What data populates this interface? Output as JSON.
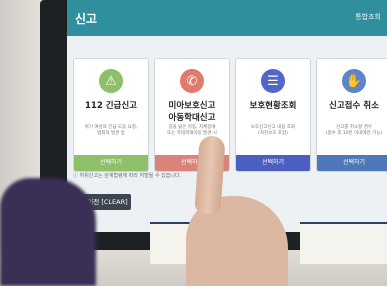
{
  "screen": {
    "title": "신고",
    "top_right": "통합조회",
    "cards": [
      {
        "title1": "112 긴급신고",
        "title2": "",
        "desc": "위기 여성의 긴급 도움 요청,\n범죄의 발견 등",
        "button": "선택하기",
        "icon": "alarm-icon",
        "icon_color": "#8fbf69",
        "button_color": "#8fbf69"
      },
      {
        "title1": "미아보호신고",
        "title2": "아동학대신고",
        "desc": "길을 잃은 아동, 지체장애\n또는 학대피해아동 발견 시",
        "button": "선택하기",
        "icon": "phone-icon",
        "icon_color": "#e07a6e",
        "button_color": "#d9847a"
      },
      {
        "title1": "보호현황조회",
        "title2": "",
        "desc": "보호신고신고 내용 조회\n(자진보호 포함)",
        "button": "선택하기",
        "icon": "list-icon",
        "icon_color": "#5067c9",
        "button_color": "#4b5fc0"
      },
      {
        "title1": "신고접수 취소",
        "title2": "",
        "desc": "신고를 취소할 경우\n(접수 후 10분 이내에만 가능)",
        "button": "선택하기",
        "icon": "hand-icon",
        "icon_color": "#5a86c9",
        "button_color": "#4f78b8"
      }
    ],
    "note": "ⓘ 허위신고는 관계법령에 따라 처벌될 수 있습니다.",
    "prev_button": "이전 [CLEAR]"
  }
}
